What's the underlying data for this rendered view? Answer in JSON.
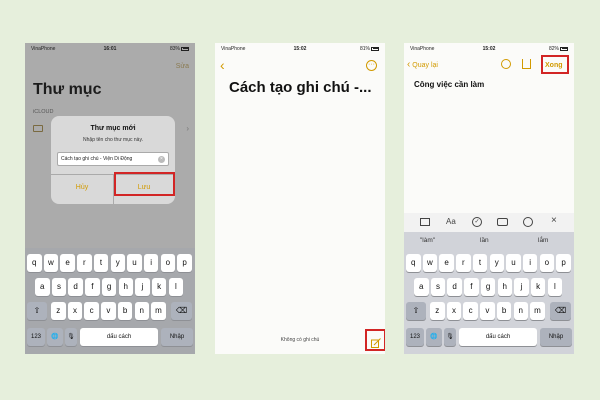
{
  "panel1": {
    "status": {
      "carrier": "VinaPhone",
      "time": "16:01",
      "battery": "83%"
    },
    "top_right": "Sửa",
    "title": "Thư mục",
    "section": "iCLOUD",
    "dialog": {
      "title": "Thư mục mới",
      "subtitle": "Nhập tên cho thư mục này.",
      "input_value": "Cách tạo ghi chú - Viện Di Động",
      "cancel": "Hủy",
      "save": "Lưu"
    }
  },
  "panel2": {
    "status": {
      "carrier": "VinaPhone",
      "time": "15:02",
      "battery": "81%"
    },
    "back_icon": "chevron-left-icon",
    "more_icon": "ellipsis-circle-icon",
    "title": "Cách tạo ghi chú -...",
    "footer": "Không có ghi chú",
    "compose_icon": "compose-icon"
  },
  "panel3": {
    "status": {
      "carrier": "VinaPhone",
      "time": "15:02",
      "battery": "82%"
    },
    "back_label": "Quay lại",
    "done_label": "Xong",
    "note_text": "Công việc cần làm",
    "toolbar_icons": [
      "table-icon",
      "text-format-icon",
      "checklist-icon",
      "camera-icon",
      "markup-icon",
      "close-icon"
    ],
    "toolbar_text_format": "Aa",
    "predictions": [
      "\"làm\"",
      "lần",
      "lắm"
    ]
  },
  "keyboard": {
    "row1": [
      "q",
      "w",
      "e",
      "r",
      "t",
      "y",
      "u",
      "i",
      "o",
      "p"
    ],
    "row2": [
      "a",
      "s",
      "d",
      "f",
      "g",
      "h",
      "j",
      "k",
      "l"
    ],
    "row3": [
      "z",
      "x",
      "c",
      "v",
      "b",
      "n",
      "m"
    ],
    "num_key": "123",
    "space": "dấu cách",
    "enter": "Nhập"
  },
  "colors": {
    "accent": "#e0a400",
    "highlight": "#d22525",
    "dim_background": "#ababab",
    "keyboard": "#d1d3d9"
  }
}
